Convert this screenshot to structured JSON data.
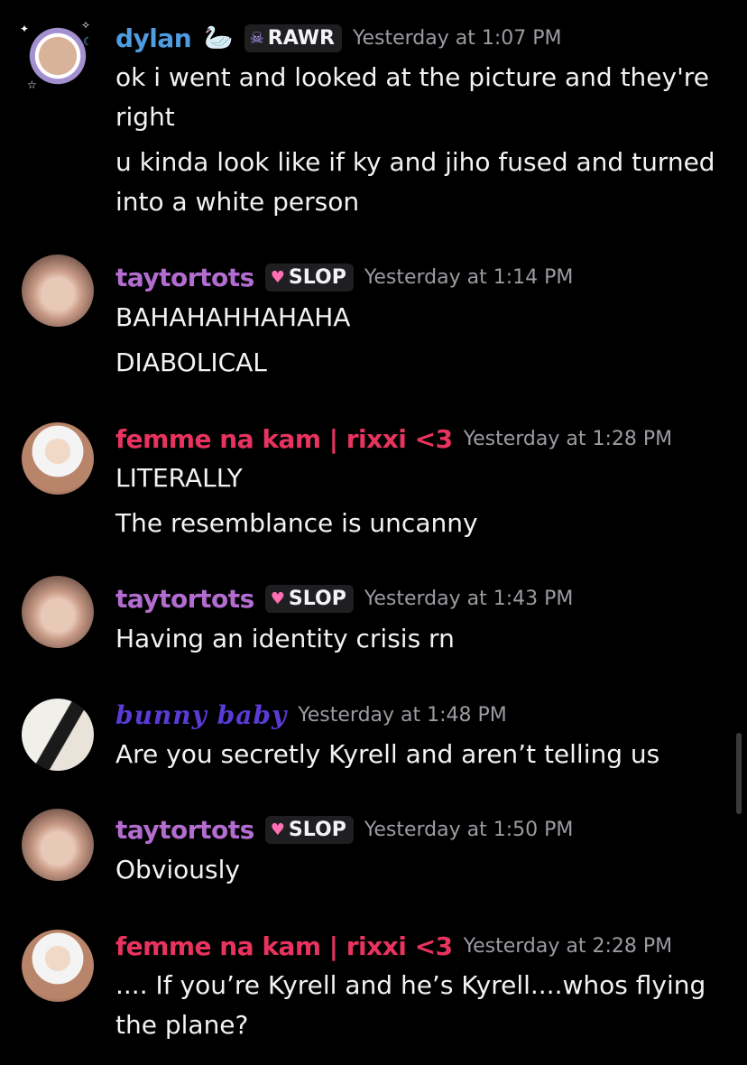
{
  "messages": [
    {
      "username": "dylan",
      "emoji": "🦢",
      "tag_icon": "skull-icon",
      "tag": "RAWR",
      "timestamp": "Yesterday at 1:07 PM",
      "lines": [
        "ok i went and looked at the picture and they're right",
        "u kinda look like if ky and jiho fused and turned into a white person"
      ]
    },
    {
      "username": "taytortots",
      "tag_icon": "heart-icon",
      "tag": "SLOP",
      "timestamp": "Yesterday at 1:14 PM",
      "lines": [
        "BAHAHAHHAHAHA",
        "DIABOLICAL"
      ]
    },
    {
      "username": "femme na kam | rixxi <3",
      "timestamp": "Yesterday at 1:28 PM",
      "lines": [
        "LITERALLY",
        "The resemblance is uncanny"
      ]
    },
    {
      "username": "taytortots",
      "tag_icon": "heart-icon",
      "tag": "SLOP",
      "timestamp": "Yesterday at 1:43 PM",
      "lines": [
        "Having an identity crisis rn"
      ]
    },
    {
      "username": "bunny baby",
      "timestamp": "Yesterday at 1:48 PM",
      "lines": [
        "Are you secretly Kyrell and aren’t telling us"
      ]
    },
    {
      "username": "taytortots",
      "tag_icon": "heart-icon",
      "tag": "SLOP",
      "timestamp": "Yesterday at 1:50 PM",
      "lines": [
        "Obviously"
      ]
    },
    {
      "username": "femme na kam | rixxi <3",
      "timestamp": "Yesterday at 2:28 PM",
      "lines": [
        ".... If you’re Kyrell and he’s Kyrell....whos flying the plane?"
      ]
    }
  ],
  "colors": {
    "background": "#000000",
    "dylan": "#4f9ce0",
    "taytortots": "#b36ccf",
    "femme": "#e8335f",
    "bunny": "#5a3bd6",
    "timestamp": "#9a9ca2",
    "text": "#f1f2f4"
  }
}
